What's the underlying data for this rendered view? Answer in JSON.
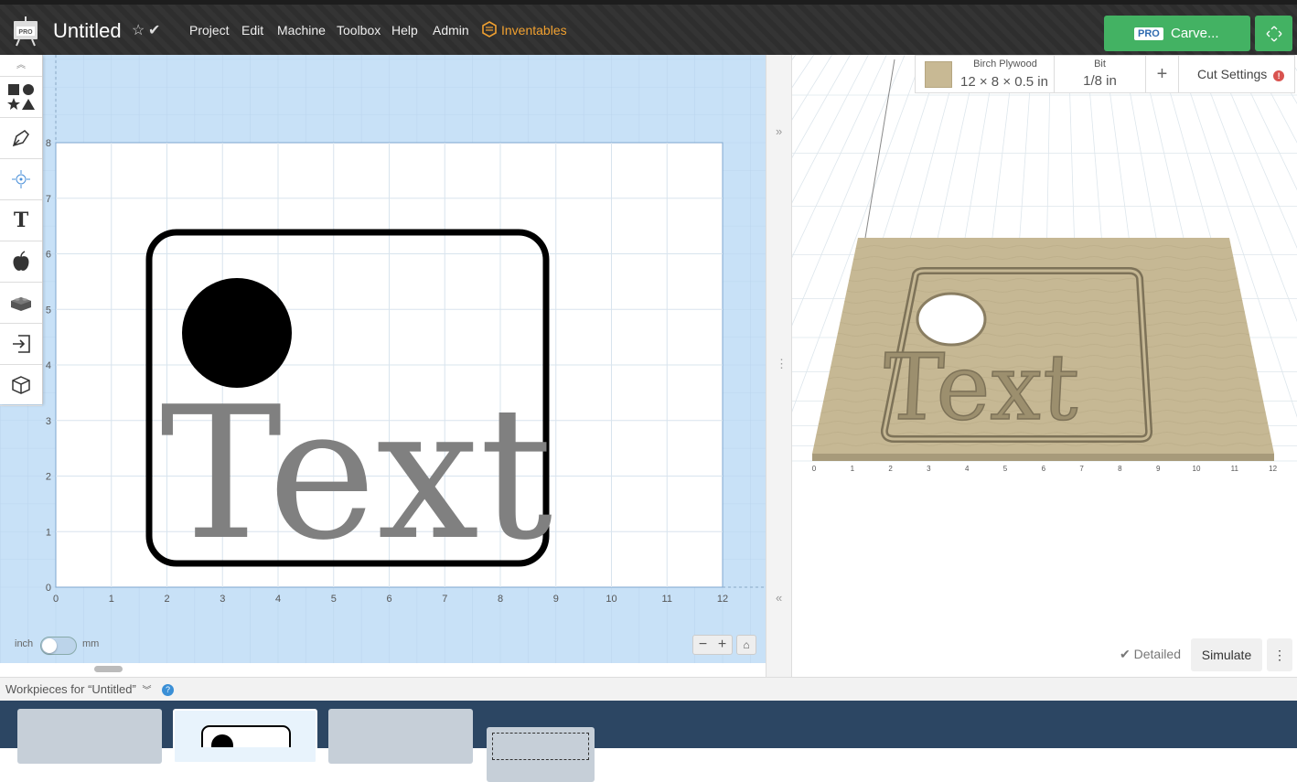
{
  "header": {
    "title": "Untitled",
    "menu": [
      "Project",
      "Edit",
      "Machine",
      "Toolbox",
      "Help",
      "Admin",
      "Inventables"
    ],
    "carve_badge": "PRO",
    "carve_label": "Carve..."
  },
  "toolbar": {
    "tools": [
      "shapes-icon",
      "pen-icon",
      "point-icon",
      "text-icon",
      "apple-icon",
      "lego-icon",
      "import-icon",
      "box-icon"
    ]
  },
  "canvas": {
    "x_ticks": [
      "0",
      "1",
      "2",
      "3",
      "4",
      "5",
      "6",
      "7",
      "8",
      "9",
      "10",
      "11",
      "12"
    ],
    "y_ticks": [
      "0",
      "1",
      "2",
      "3",
      "4",
      "5",
      "6",
      "7",
      "8"
    ],
    "design_text": "Text",
    "unit_left": "inch",
    "unit_right": "mm",
    "zoom_out": "−",
    "zoom_in": "+"
  },
  "preview": {
    "material_name": "Birch Plywood",
    "material_size": "12 × 8 × 0.5 in",
    "bit_label": "Bit",
    "bit_value": "1/8 in",
    "add_label": "+",
    "cut_settings": "Cut Settings",
    "x_ticks": [
      "0",
      "1",
      "2",
      "3",
      "4",
      "5",
      "6",
      "7",
      "8",
      "9",
      "10",
      "11",
      "12"
    ],
    "detailed_label": "Detailed",
    "simulate_label": "Simulate"
  },
  "workpieces": {
    "header": "Workpieces for “Untitled”"
  }
}
